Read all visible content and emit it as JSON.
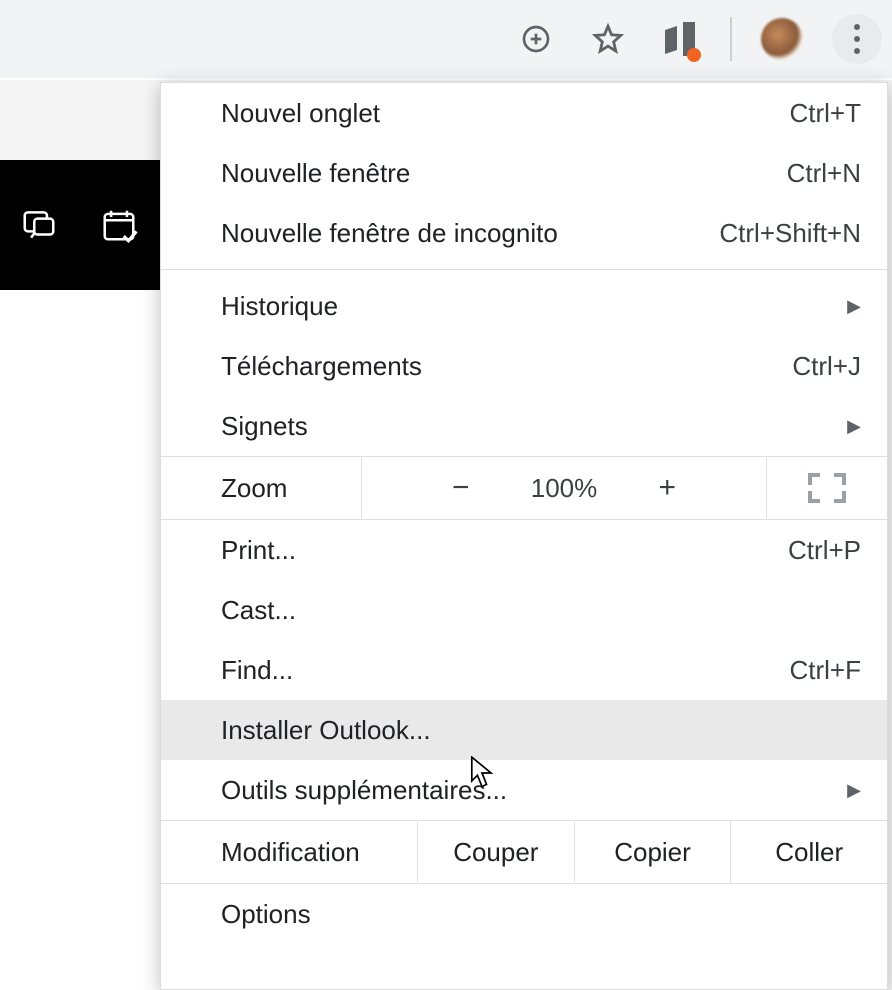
{
  "toolbar": {
    "add_tooltip": "Add",
    "star_tooltip": "Bookmark",
    "ext_tooltip": "Office",
    "profile_tooltip": "Profile",
    "menu_tooltip": "Menu"
  },
  "menu": {
    "new_tab": {
      "label": "Nouvel onglet",
      "shortcut": "Ctrl+T"
    },
    "new_window": {
      "label": "Nouvelle fenêtre",
      "shortcut": "Ctrl+N"
    },
    "incognito": {
      "label": "Nouvelle fenêtre de incognito",
      "shortcut": "Ctrl+Shift+N"
    },
    "history": {
      "label": "Historique"
    },
    "downloads": {
      "label": "Téléchargements",
      "shortcut": "Ctrl+J"
    },
    "bookmarks": {
      "label": "Signets"
    },
    "zoom": {
      "label": "Zoom",
      "value": "100%"
    },
    "print": {
      "label": "Print...",
      "shortcut": "Ctrl+P"
    },
    "cast": {
      "label": "Cast..."
    },
    "find": {
      "label": "Find...",
      "shortcut": "Ctrl+F"
    },
    "install": {
      "label": "Installer Outlook..."
    },
    "more_tools": {
      "label": "Outils supplémentaires..."
    },
    "edit": {
      "label": "Modification",
      "cut": "Couper",
      "copy": "Copier",
      "paste": "Coller"
    },
    "options": {
      "label": "Options"
    }
  }
}
